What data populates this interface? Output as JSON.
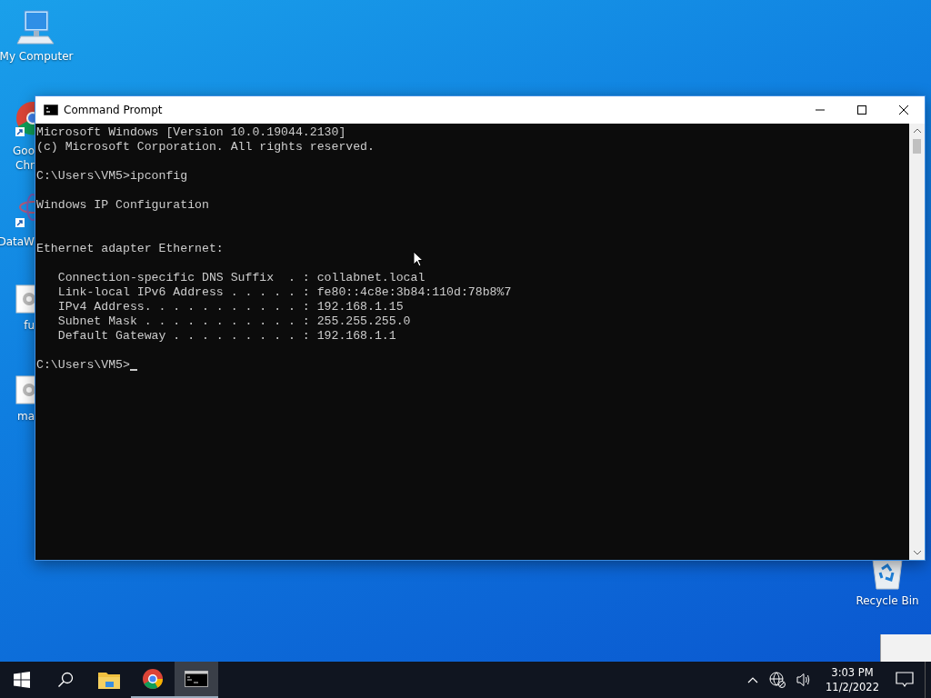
{
  "desktop": {
    "icons": [
      {
        "kind": "computer",
        "lines": [
          "My Computer"
        ]
      },
      {
        "kind": "chrome",
        "lines": [
          "Goo",
          "Chr"
        ]
      },
      {
        "kind": "molecule",
        "lines": [
          "DataW"
        ]
      },
      {
        "kind": "file",
        "lines": [
          "fu"
        ]
      },
      {
        "kind": "file",
        "lines": [
          "ma"
        ]
      }
    ],
    "recycle_bin": {
      "label": "Recycle Bin"
    }
  },
  "window": {
    "title": "Command Prompt",
    "console": {
      "output": "Microsoft Windows [Version 10.0.19044.2130]\n(c) Microsoft Corporation. All rights reserved.\n\nC:\\Users\\VM5>ipconfig\n\nWindows IP Configuration\n\n\nEthernet adapter Ethernet:\n\n   Connection-specific DNS Suffix  . : collabnet.local\n   Link-local IPv6 Address . . . . . : fe80::4c8e:3b84:110d:78b8%7\n   IPv4 Address. . . . . . . . . . . : 192.168.1.15\n   Subnet Mask . . . . . . . . . . . : 255.255.255.0\n   Default Gateway . . . . . . . . . : 192.168.1.1",
      "prompt": "C:\\Users\\VM5>"
    }
  },
  "taskbar": {
    "items": [
      {
        "kind": "start",
        "selected": false,
        "running": false
      },
      {
        "kind": "search",
        "selected": false,
        "running": false
      },
      {
        "kind": "explorer",
        "selected": false,
        "running": false
      },
      {
        "kind": "chrome",
        "selected": false,
        "running": true
      },
      {
        "kind": "cmd",
        "selected": true,
        "running": true
      }
    ],
    "tray": {
      "time": "3:03 PM",
      "date": "11/2/2022"
    }
  }
}
